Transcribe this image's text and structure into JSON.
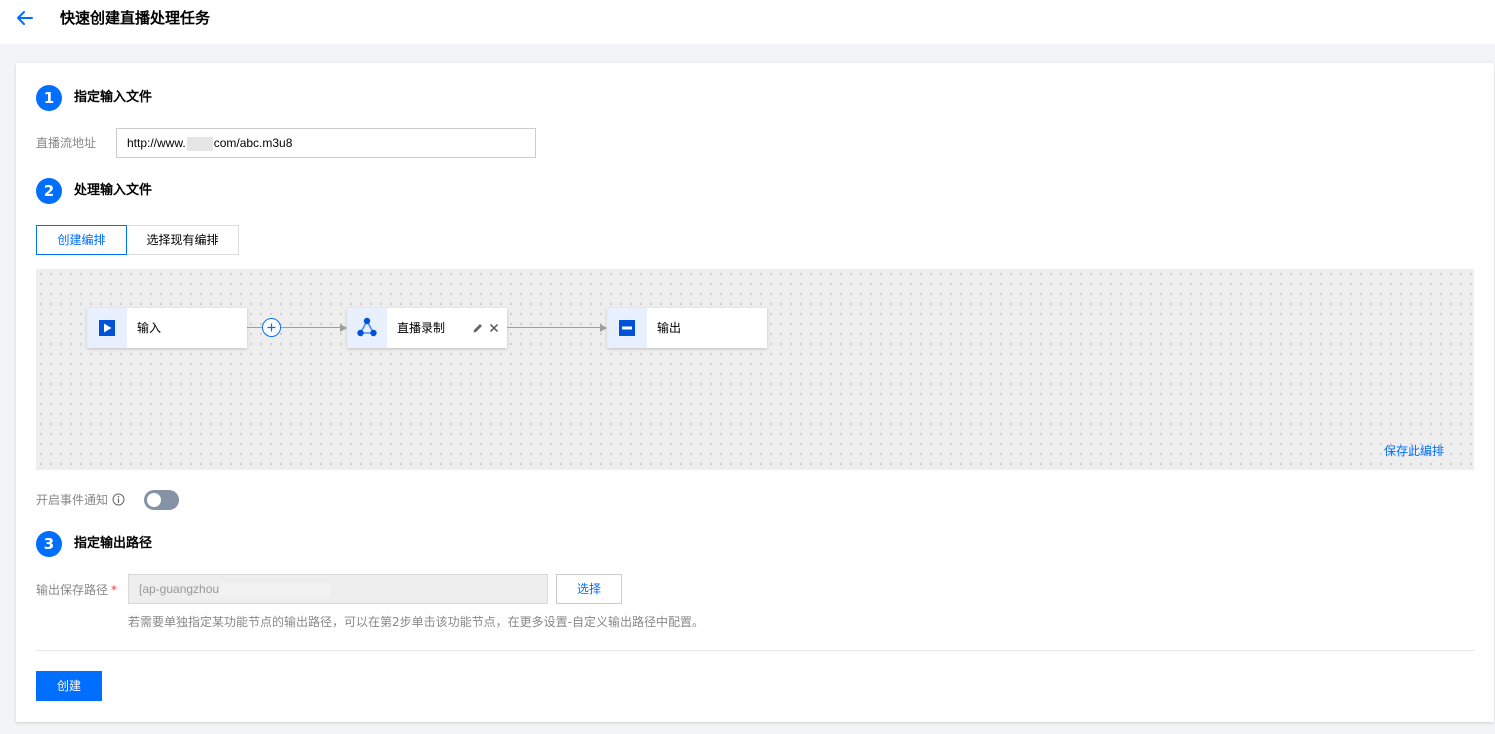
{
  "header": {
    "back_icon": "arrow-left-icon",
    "title": "快速创建直播处理任务"
  },
  "steps": [
    {
      "number": "1",
      "title": "指定输入文件"
    },
    {
      "number": "2",
      "title": "处理输入文件"
    },
    {
      "number": "3",
      "title": "指定输出路径"
    }
  ],
  "input_section": {
    "stream_label": "直播流地址",
    "stream_value_prefix": "http://www.",
    "stream_value_suffix": "com/abc.m3u8"
  },
  "process_section": {
    "tabs": [
      {
        "label": "创建编排",
        "active": true
      },
      {
        "label": "选择现有编排",
        "active": false
      }
    ],
    "nodes": [
      {
        "label": "输入",
        "icon": "play-icon"
      },
      {
        "label": "直播录制",
        "icon": "live-record-icon"
      },
      {
        "label": "输出",
        "icon": "output-icon"
      }
    ],
    "save_link": "保存此编排",
    "event_notify_label": "开启事件通知",
    "event_notify_enabled": false
  },
  "output_section": {
    "path_label": "输出保存路径",
    "required_mark": "*",
    "path_value": "[ap-guangzhou",
    "select_button": "选择",
    "hint": "若需要单独指定某功能节点的输出路径，可以在第2步单击该功能节点，在更多设置-自定义输出路径中配置。"
  },
  "footer": {
    "create_button": "创建"
  },
  "colors": {
    "accent": "#006eff",
    "toggle_off": "#8592a6",
    "canvas_bg": "#eeeeee"
  }
}
